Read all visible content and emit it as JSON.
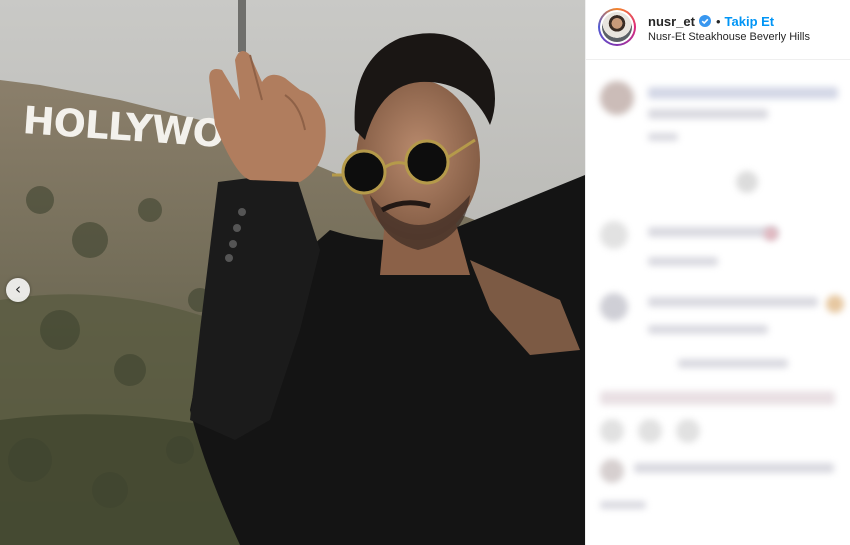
{
  "post": {
    "username": "nusr_et",
    "separator": "•",
    "follow_label": "Takip Et",
    "location": "Nusr-Et Steakhouse Beverly Hills",
    "photo_sign_text": "HOLLYWOOD",
    "verified_icon": "verified-badge-icon",
    "prev_icon": "chevron-left-icon",
    "prev_glyph": "‹"
  },
  "colors": {
    "link_blue": "#0095f6",
    "text": "#262626",
    "border": "#efefef"
  }
}
